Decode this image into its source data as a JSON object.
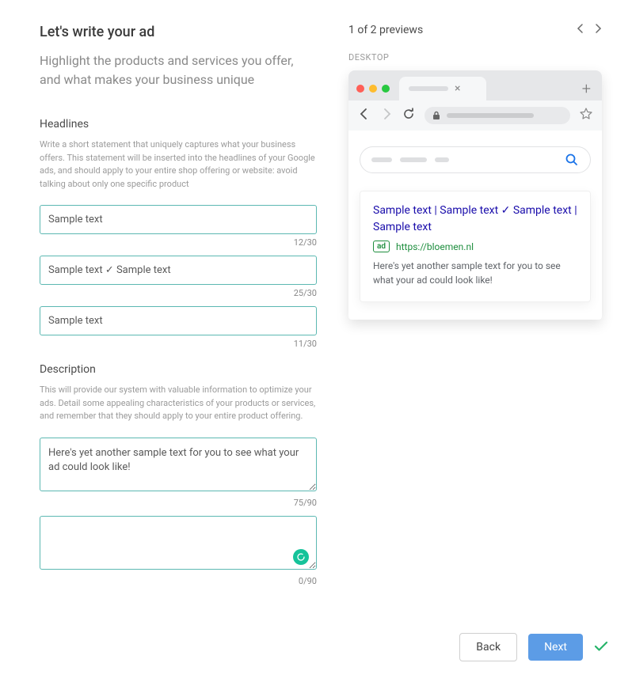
{
  "page": {
    "title": "Let's write your ad",
    "subtitle": "Highlight the products and services you offer, and what makes your business unique"
  },
  "headlines_section": {
    "label": "Headlines",
    "help": "Write a short statement that uniquely captures what your business offers. This statement will be inserted into the headlines of your Google ads, and should apply to your entire shop offering or website: avoid talking about only one specific product",
    "inputs": [
      {
        "value": "Sample text",
        "count": "12/30"
      },
      {
        "value": "Sample text ✓ Sample text",
        "count": "25/30"
      },
      {
        "value": "Sample text",
        "count": "11/30"
      }
    ]
  },
  "description_section": {
    "label": "Description",
    "help": "This will provide our system with valuable information to optimize your ads. Detail some appealing characteristics of your products or services, and remember that they should apply to your entire product offering.",
    "inputs": [
      {
        "value": "Here's yet another sample text for you to see what your ad could look like!",
        "count": "75/90"
      },
      {
        "value": "",
        "count": "0/90"
      }
    ]
  },
  "preview": {
    "counter": "1 of 2 previews",
    "mode_label": "DESKTOP",
    "ad": {
      "headline": "Sample text | Sample text ✓ Sample text | Sample text",
      "badge": "ad",
      "url": "https://bloemen.nl",
      "description": "Here's yet another sample text for you to see what your ad could look like!"
    }
  },
  "footer": {
    "back": "Back",
    "next": "Next"
  }
}
